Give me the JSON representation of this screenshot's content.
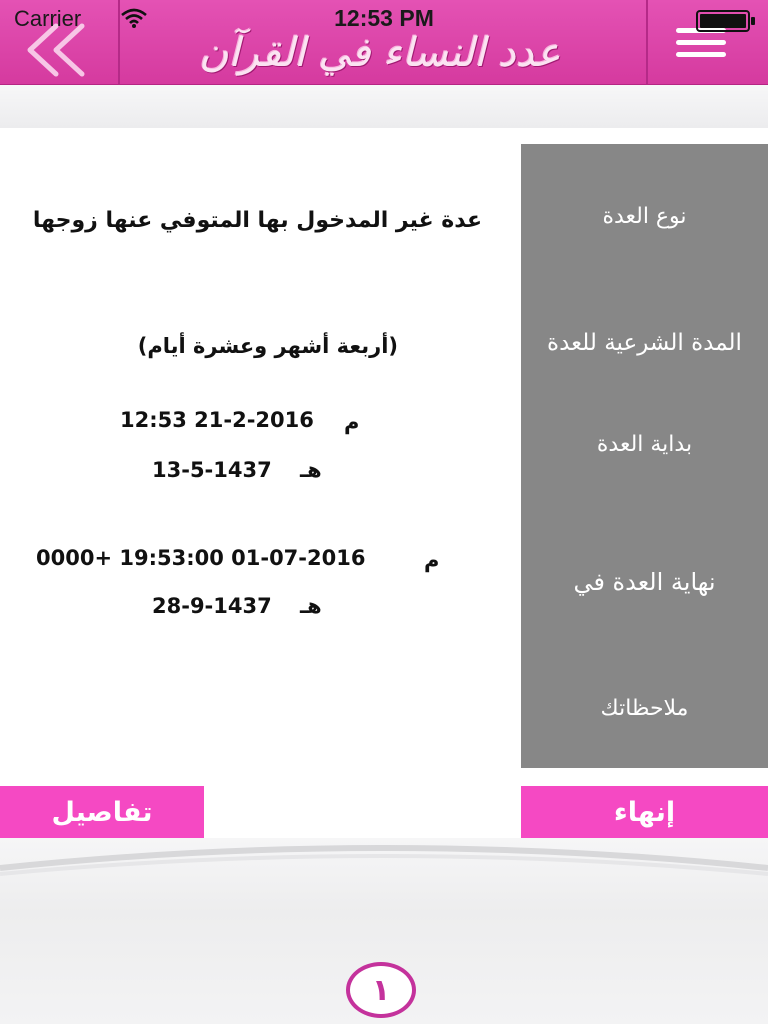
{
  "status_bar": {
    "carrier": "Carrier",
    "time": "12:53 PM"
  },
  "header": {
    "logo_text": "عدد النساء في القرآن",
    "back_icon": "double-chevron-left-icon",
    "menu_icon": "hamburger-menu-icon"
  },
  "labels": {
    "iddah_type": "نوع العدة",
    "legal_period": "المدة الشرعية للعدة",
    "start": "بداية العدة",
    "end": "نهاية العدة في",
    "notes": "ملاحظاتك"
  },
  "values": {
    "iddah_type": "عدة غير المدخول بها المتوفي عنها زوجها",
    "legal_period": "(أربعة أشهر وعشرة أيام)",
    "start_gregorian_suffix": "م",
    "start_gregorian": "12:53 21-2-2016",
    "start_hijri_suffix": "هـ",
    "start_hijri": "13-5-1437",
    "end_gregorian_suffix": "م",
    "end_gregorian": "0000+ 19:53:00 01-07-2016",
    "end_hijri_suffix": "هـ",
    "end_hijri": "28-9-1437"
  },
  "buttons": {
    "finish": "إنهاء",
    "details": "تفاصيل"
  },
  "page_badge": "١",
  "colors": {
    "header_pink": "#d944a8",
    "button_pink": "#f549c3",
    "panel_gray": "#878787"
  }
}
